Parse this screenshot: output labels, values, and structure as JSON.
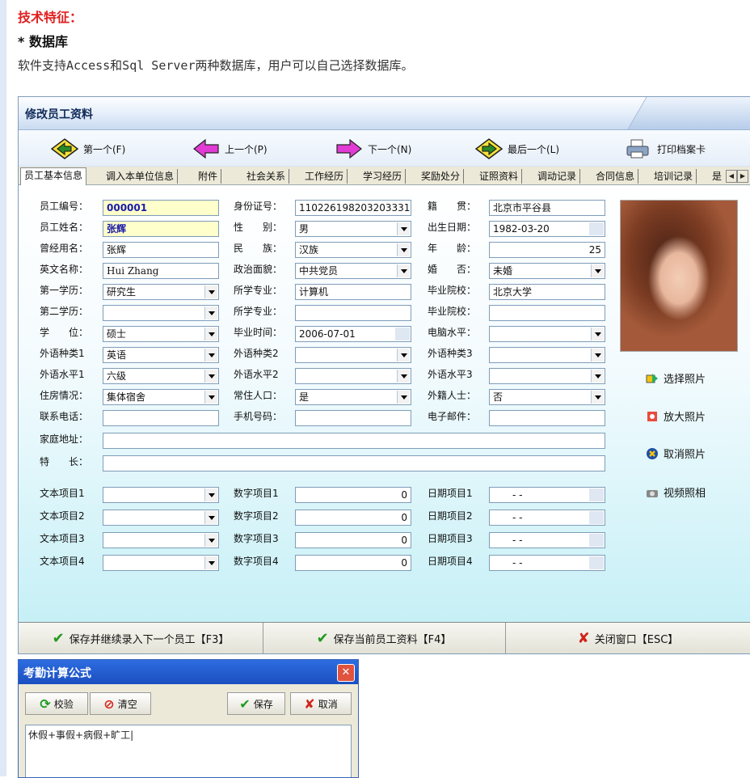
{
  "page": {
    "heading": "技术特征：",
    "subheading": "* 数据库",
    "intro": "软件支持Access和Sql Server两种数据库，用户可以自己选择数据库。"
  },
  "window": {
    "title": "修改员工资料",
    "nav": {
      "first": "第一个(F)",
      "prev": "上一个(P)",
      "next": "下一个(N)",
      "last": "最后一个(L)",
      "print": "打印档案卡"
    },
    "tabs": [
      "员工基本信息",
      "调入本单位信息",
      "附件",
      "社会关系",
      "工作经历",
      "学习经历",
      "奖励处分",
      "证照资料",
      "调动记录",
      "合同信息",
      "培训记录",
      "是"
    ],
    "form": {
      "emp_no": {
        "label": "员工编号：",
        "value": "000001"
      },
      "emp_name": {
        "label": "员工姓名：",
        "value": "张辉"
      },
      "former_name": {
        "label": "曾经用名：",
        "value": "张辉"
      },
      "english_name": {
        "label": "英文名称：",
        "value": "Hui Zhang"
      },
      "edu1": {
        "label": "第一学历：",
        "value": "研究生"
      },
      "edu2": {
        "label": "第二学历：",
        "value": ""
      },
      "degree": {
        "label": "学　　位：",
        "value": "硕士"
      },
      "lang_type1": {
        "label": "外语种类1",
        "value": "英语"
      },
      "lang_level1": {
        "label": "外语水平1",
        "value": "六级"
      },
      "housing": {
        "label": "住房情况：",
        "value": "集体宿舍"
      },
      "phone": {
        "label": "联系电话：",
        "value": ""
      },
      "address": {
        "label": "家庭地址：",
        "value": ""
      },
      "specialty": {
        "label": "特　　长：",
        "value": ""
      },
      "id_no": {
        "label": "身份证号：",
        "value": "110226198203203331"
      },
      "gender": {
        "label": "性　　别：",
        "value": "男"
      },
      "ethnicity": {
        "label": "民　　族：",
        "value": "汉族"
      },
      "politics": {
        "label": "政治面貌：",
        "value": "中共党员"
      },
      "major1": {
        "label": "所学专业：",
        "value": "计算机"
      },
      "major2": {
        "label": "所学专业：",
        "value": ""
      },
      "grad_date": {
        "label": "毕业时间：",
        "value": "2006-07-01"
      },
      "lang_type2": {
        "label": "外语种类2",
        "value": ""
      },
      "lang_level2": {
        "label": "外语水平2",
        "value": ""
      },
      "resident": {
        "label": "常住人口：",
        "value": "是"
      },
      "mobile": {
        "label": "手机号码：",
        "value": ""
      },
      "native": {
        "label": "籍　　贯：",
        "value": "北京市平谷县"
      },
      "birth": {
        "label": "出生日期：",
        "value": "1982-03-20"
      },
      "age": {
        "label": "年　　龄：",
        "value": "25"
      },
      "marital": {
        "label": "婚　　否：",
        "value": "未婚"
      },
      "school1": {
        "label": "毕业院校：",
        "value": "北京大学"
      },
      "school2": {
        "label": "毕业院校：",
        "value": ""
      },
      "computer": {
        "label": "电脑水平：",
        "value": ""
      },
      "lang_type3": {
        "label": "外语种类3",
        "value": ""
      },
      "lang_level3": {
        "label": "外语水平3",
        "value": ""
      },
      "foreign": {
        "label": "外籍人士：",
        "value": "否"
      },
      "email": {
        "label": "电子邮件：",
        "value": ""
      },
      "text_items": [
        "文本项目1",
        "文本项目2",
        "文本项目3",
        "文本项目4"
      ],
      "num_items": [
        "数字项目1",
        "数字项目2",
        "数字项目3",
        "数字项目4"
      ],
      "num_value": "0",
      "date_items": [
        "日期项目1",
        "日期项目2",
        "日期项目3",
        "日期项目4"
      ],
      "date_placeholder": "-  -"
    },
    "photo_actions": {
      "select": "选择照片",
      "enlarge": "放大照片",
      "cancel": "取消照片",
      "video": "视频照相"
    },
    "bottom": {
      "save_next": "保存并继续录入下一个员工【F3】",
      "save": "保存当前员工资料【F4】",
      "close": "关闭窗口【ESC】"
    }
  },
  "dialog": {
    "title": "考勤计算公式",
    "verify": "校验",
    "clear": "清空",
    "save": "保存",
    "cancel": "取消",
    "formula": "休假+事假+病假+旷工|"
  },
  "colors": {
    "accent_red": "#e02020",
    "title_blue": "#102a58",
    "yellow_field": "#ffffcc"
  }
}
